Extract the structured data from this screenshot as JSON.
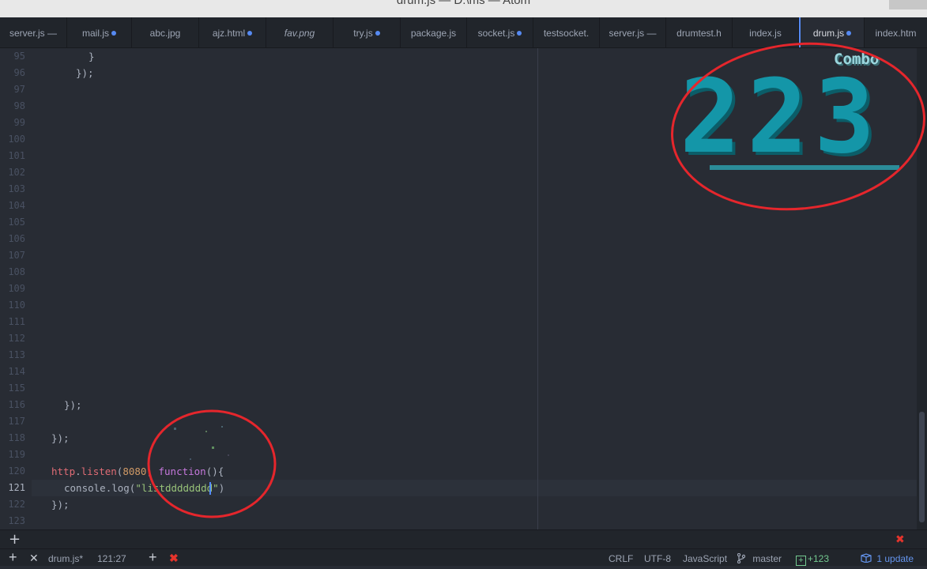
{
  "window": {
    "title": "drum.js — D:\\ms — Atom"
  },
  "tabs": [
    {
      "label": "server.js —",
      "modified": false,
      "italic": false,
      "active": false
    },
    {
      "label": "mail.js",
      "modified": true,
      "italic": false,
      "active": false
    },
    {
      "label": "abc.jpg",
      "modified": false,
      "italic": false,
      "active": false
    },
    {
      "label": "ajz.html",
      "modified": true,
      "italic": false,
      "active": false
    },
    {
      "label": "fav.png",
      "modified": false,
      "italic": true,
      "active": false
    },
    {
      "label": "try.js",
      "modified": true,
      "italic": false,
      "active": false
    },
    {
      "label": "package.js",
      "modified": false,
      "italic": false,
      "active": false
    },
    {
      "label": "socket.js",
      "modified": true,
      "italic": false,
      "active": false
    },
    {
      "label": "testsocket.",
      "modified": false,
      "italic": false,
      "active": false
    },
    {
      "label": "server.js —",
      "modified": false,
      "italic": false,
      "active": false
    },
    {
      "label": "drumtest.h",
      "modified": false,
      "italic": false,
      "active": false
    },
    {
      "label": "index.js",
      "modified": false,
      "italic": false,
      "active": false
    },
    {
      "label": "drum.js",
      "modified": true,
      "italic": false,
      "active": true
    },
    {
      "label": "index.htm",
      "modified": false,
      "italic": false,
      "active": false
    }
  ],
  "editor": {
    "line_numbers": [
      "95",
      "96",
      "97",
      "98",
      "99",
      "100",
      "101",
      "102",
      "103",
      "104",
      "105",
      "106",
      "107",
      "108",
      "109",
      "110",
      "111",
      "112",
      "113",
      "114",
      "115",
      "116",
      "117",
      "118",
      "119",
      "120",
      "121",
      "122",
      "123"
    ],
    "current_line": "121",
    "code": {
      "l95": "}",
      "l96": "});",
      "l116": "});",
      "l118": "});",
      "l120_obj": "http",
      "l120_dot": ".",
      "l120_fn": "listen",
      "l120_open": "(",
      "l120_num": "8080",
      "l120_comma": ", ",
      "l120_kw": "function",
      "l120_rest": "(){",
      "l121_obj": "console",
      "l121_dot": ".",
      "l121_fn": "log",
      "l121_open": "(",
      "l121_str": "\"listdddddddd\"",
      "l121_close": ")",
      "l122": "});"
    }
  },
  "combo": {
    "label": "Combo",
    "count": "223"
  },
  "panel": {
    "add_label": "+",
    "close_label": "✖"
  },
  "status": {
    "add_label": "+",
    "close_label": "✕",
    "file": "drum.js*",
    "cursor_pos": "121:27",
    "add2_label": "+",
    "close2_label": "✖",
    "line_ending": "CRLF",
    "encoding": "UTF-8",
    "grammar": "JavaScript",
    "branch_icon": "branch-icon",
    "branch": "master",
    "git_added_icon": "+",
    "git_added": "+123",
    "update_icon": "package-icon",
    "updates": "1 update"
  },
  "colors": {
    "accent": "#568af2",
    "annotation": "#e5262c",
    "combo": "#1496a8"
  }
}
